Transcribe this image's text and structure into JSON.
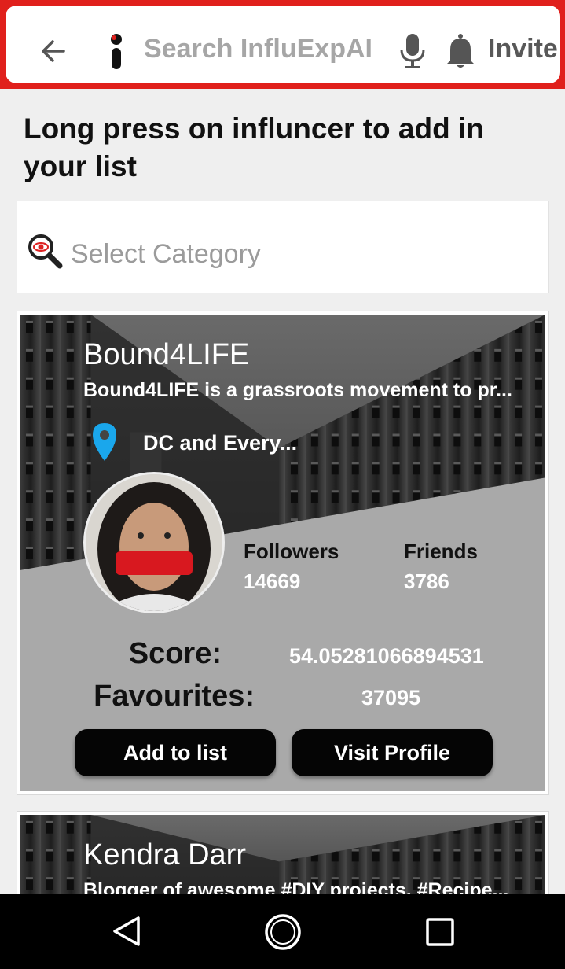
{
  "header": {
    "search_placeholder": "Search InfluExpAI",
    "invite_label": "Invite",
    "back_icon": "arrow-left-icon",
    "logo_icon": "info-logo-icon",
    "mic_icon": "microphone-icon",
    "bell_icon": "bell-icon",
    "accent_color": "#e0201c"
  },
  "hint": "Long press on influncer to add in your list",
  "category": {
    "placeholder": "Select Category",
    "icon": "magnifier-eye-icon"
  },
  "cards": [
    {
      "name": "Bound4LIFE",
      "bio": "Bound4LIFE is a grassroots movement to pr...",
      "location": "DC and Every...",
      "followers_label": "Followers",
      "followers": "14669",
      "friends_label": "Friends",
      "friends": "3786",
      "score_label": "Score:",
      "score": "54.05281066894531",
      "favourites_label": "Favourites:",
      "favourites": "37095",
      "add_button": "Add to list",
      "visit_button": "Visit Profile"
    },
    {
      "name": "Kendra Darr",
      "bio": "Blogger of awesome #DIY projects, #Recipe..."
    }
  ],
  "navbar": {
    "back_icon": "nav-back-triangle-icon",
    "home_icon": "nav-home-circle-icon",
    "recent_icon": "nav-recent-square-icon"
  }
}
